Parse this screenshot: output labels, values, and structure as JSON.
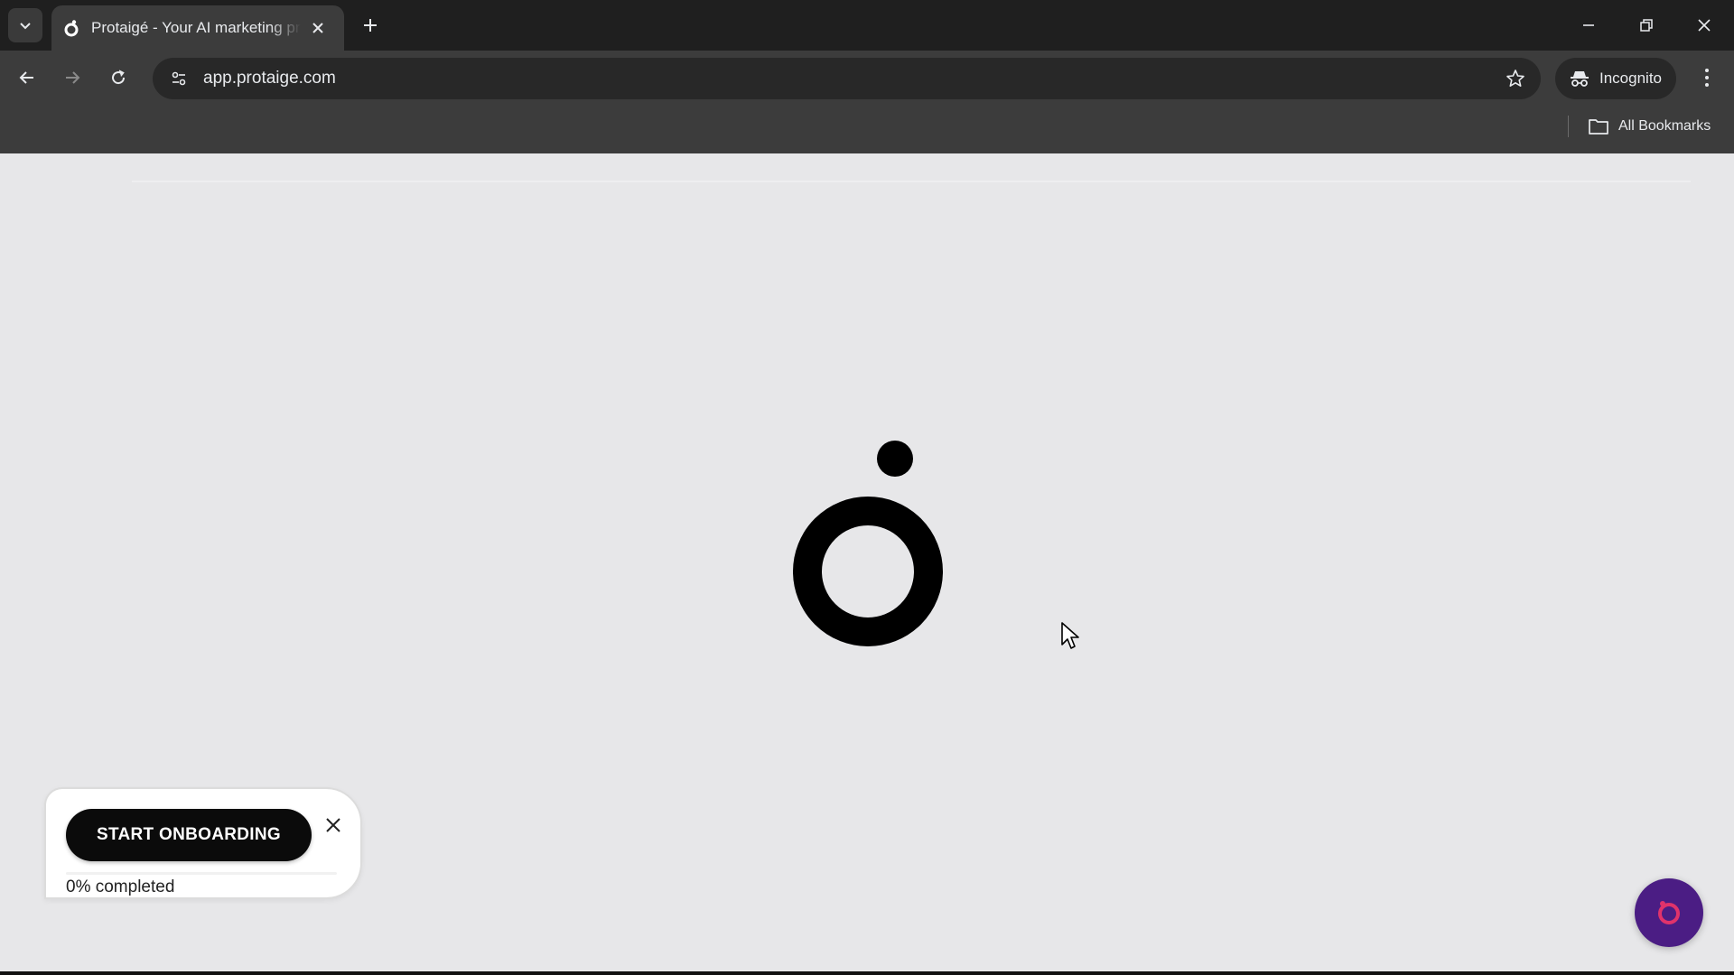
{
  "browser": {
    "tab": {
      "title": "Protaigé - Your AI marketing pr",
      "favicon": "protaige-logo-icon"
    },
    "url": "app.protaige.com",
    "incognito_label": "Incognito",
    "bookmarks_label": "All Bookmarks"
  },
  "page": {
    "logo": "protaige-logo",
    "onboarding": {
      "button_label": "START ONBOARDING",
      "progress_text": "0% completed",
      "progress_fraction": 0
    },
    "chat_button_icon": "chat-widget-icon"
  },
  "colors": {
    "page_background": "#e7e7e9",
    "chrome_dark": "#1f1f1f",
    "toolbar": "#3c3c3c",
    "button_black": "#0b0b0b",
    "chat_fab": "#4b1d84",
    "chat_icon_accent": "#e0336b"
  }
}
